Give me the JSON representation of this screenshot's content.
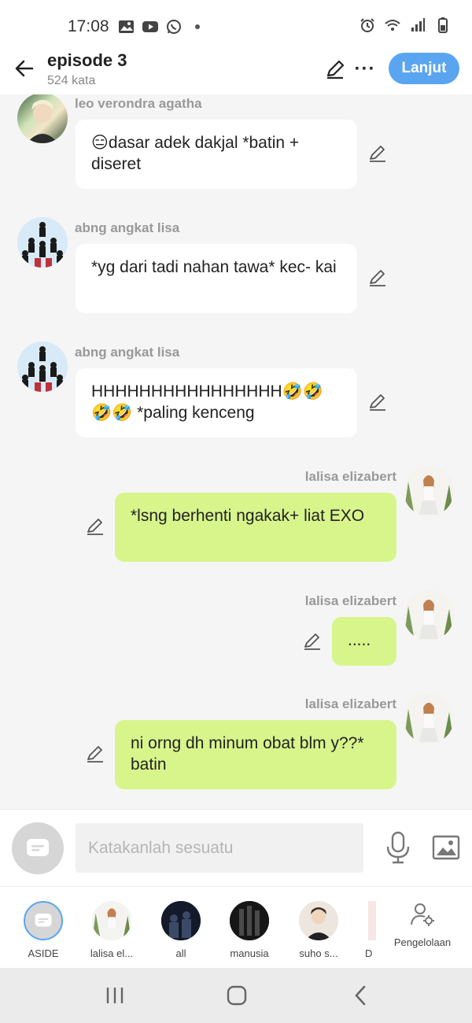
{
  "status_bar": {
    "time": "17:08"
  },
  "header": {
    "title": "episode 3",
    "word_count": "524 kata",
    "next_label": "Lanjut",
    "more_label": "···"
  },
  "messages": [
    {
      "side": "left",
      "sender": "leo verondra agatha",
      "text": "😑dasar adek dakjal *batin + diseret",
      "avatar": "avatar-blonde"
    },
    {
      "side": "left",
      "sender": "abng angkat lisa",
      "text": "*yg dari tadi nahan tawa* kec- kai",
      "avatar": "avatar-group"
    },
    {
      "side": "left",
      "sender": "abng angkat lisa",
      "text": "HHHHHHHHHHHHHHHH🤣🤣🤣🤣 *paling kenceng",
      "avatar": "avatar-group"
    },
    {
      "side": "right",
      "sender": "lalisa elizabert",
      "text": "*lsng berhenti ngakak+ liat EXO",
      "avatar": "avatar-lisa"
    },
    {
      "side": "right",
      "sender": "lalisa elizabert",
      "text": ".....",
      "avatar": "avatar-lisa"
    },
    {
      "side": "right",
      "sender": "lalisa elizabert",
      "text": "ni orng dh minum obat blm y??* batin",
      "avatar": "avatar-lisa"
    }
  ],
  "input": {
    "placeholder": "Katakanlah sesuatu"
  },
  "characters": [
    {
      "label": "ASIDE"
    },
    {
      "label": "lalisa el..."
    },
    {
      "label": "all"
    },
    {
      "label": "manusia"
    },
    {
      "label": "suho s..."
    },
    {
      "label": "D"
    }
  ],
  "manage_label": "Pengelolaan",
  "colors": {
    "accent_blue": "#5aa5f0",
    "bubble_right": "#d8f58c",
    "bubble_left": "#ffffff",
    "background": "#f5f5f5"
  }
}
